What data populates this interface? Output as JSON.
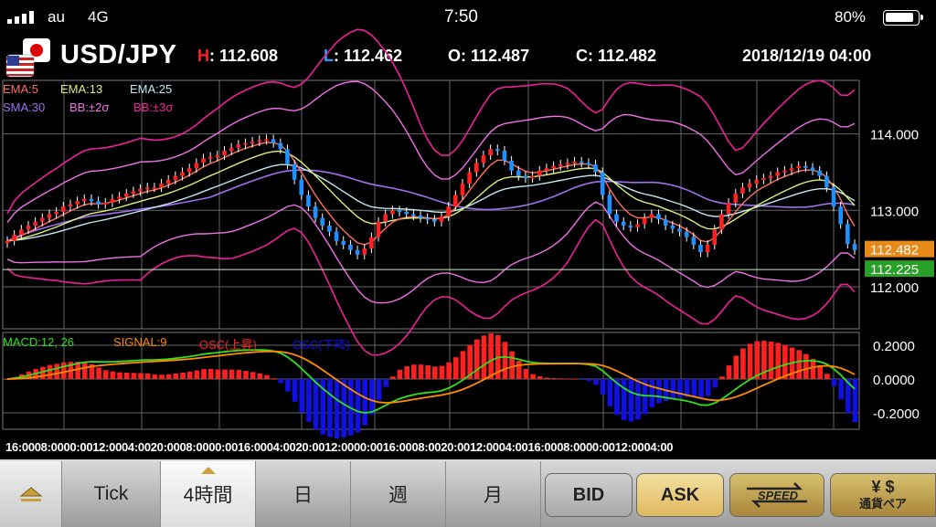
{
  "status_bar": {
    "carrier": "au",
    "network": "4G",
    "time": "7:50",
    "battery": "80%"
  },
  "header": {
    "pair": "USD/JPY",
    "high_label": "H",
    "high": ": 112.608",
    "low_label": "L",
    "low": ": 112.462",
    "open_label": "O",
    "open": ": 112.487",
    "close_label": "C",
    "close": ": 112.482",
    "datetime": "2018/12/19 04:00"
  },
  "legend": {
    "row1": [
      "EMA:5",
      "EMA:13",
      "EMA:25"
    ],
    "row2": [
      "SMA:30",
      "BB:±2σ",
      "BB:±3σ"
    ],
    "macd": [
      "MACD:12, 26",
      "SIGNAL:9",
      "OSC(上昇)",
      "OSC(下降)"
    ]
  },
  "colors": {
    "ema5": "#ff7060",
    "ema13": "#d8f07a",
    "ema25": "#bfe8f0",
    "sma30": "#a070f0",
    "bb2": "#f070e8",
    "bb3": "#f0209a",
    "up": "#ff2020",
    "down": "#1e90ff",
    "macd": "#30e020",
    "signal": "#ff8c00",
    "osc_up": "#ff2020",
    "osc_down": "#1010e0"
  },
  "price_axis": [
    "114.000",
    "113.000",
    "112.000"
  ],
  "price_tags": {
    "current": "112.482",
    "line": "112.225"
  },
  "osc_axis": [
    "0.2000",
    "0.0000",
    "-0.2000"
  ],
  "x_axis_label": "16:0008:0000:0012:0004:0020:0008:0000:0016:0004:0020:0012:0000:0016:0008:0020:0012:0004:0016:0008:0000:0012:0004:00",
  "tabs": {
    "tick": "Tick",
    "h4": "4時間",
    "day": "日",
    "week": "週",
    "month": "月"
  },
  "buttons": {
    "bid": "BID",
    "ask": "ASK",
    "speed": "SPEED",
    "currency": "通貨ペア"
  },
  "chart_data": {
    "type": "candlestick",
    "timeframe": "4時間",
    "ylim": [
      111.45,
      114.7
    ],
    "yticks": [
      114.0,
      113.0,
      112.0
    ],
    "osc_ticks": [
      0.2,
      0.0,
      -0.2
    ],
    "close": [
      112.6,
      112.68,
      112.75,
      112.8,
      112.85,
      112.9,
      112.95,
      112.98,
      113.05,
      113.08,
      113.12,
      113.15,
      113.12,
      113.08,
      113.1,
      113.15,
      113.18,
      113.22,
      113.25,
      113.28,
      113.3,
      113.3,
      113.35,
      113.4,
      113.45,
      113.5,
      113.55,
      113.62,
      113.68,
      113.7,
      113.72,
      113.78,
      113.82,
      113.86,
      113.88,
      113.9,
      113.92,
      113.93,
      113.88,
      113.8,
      113.6,
      113.4,
      113.2,
      113.05,
      112.9,
      112.8,
      112.72,
      112.6,
      112.55,
      112.48,
      112.42,
      112.5,
      112.65,
      112.85,
      112.95,
      113.0,
      112.98,
      112.95,
      112.93,
      112.9,
      112.88,
      112.85,
      112.92,
      113.05,
      113.2,
      113.35,
      113.5,
      113.62,
      113.72,
      113.8,
      113.78,
      113.65,
      113.52,
      113.45,
      113.42,
      113.45,
      113.52,
      113.55,
      113.58,
      113.6,
      113.62,
      113.64,
      113.62,
      113.6,
      113.5,
      113.2,
      112.95,
      112.85,
      112.8,
      112.78,
      112.82,
      112.9,
      112.95,
      112.88,
      112.8,
      112.76,
      112.72,
      112.65,
      112.55,
      112.45,
      112.55,
      112.75,
      112.95,
      113.1,
      113.22,
      113.3,
      113.35,
      113.4,
      113.42,
      113.45,
      113.5,
      113.52,
      113.55,
      113.58,
      113.56,
      113.52,
      113.45,
      113.3,
      113.05,
      112.82,
      112.56,
      112.48
    ]
  }
}
